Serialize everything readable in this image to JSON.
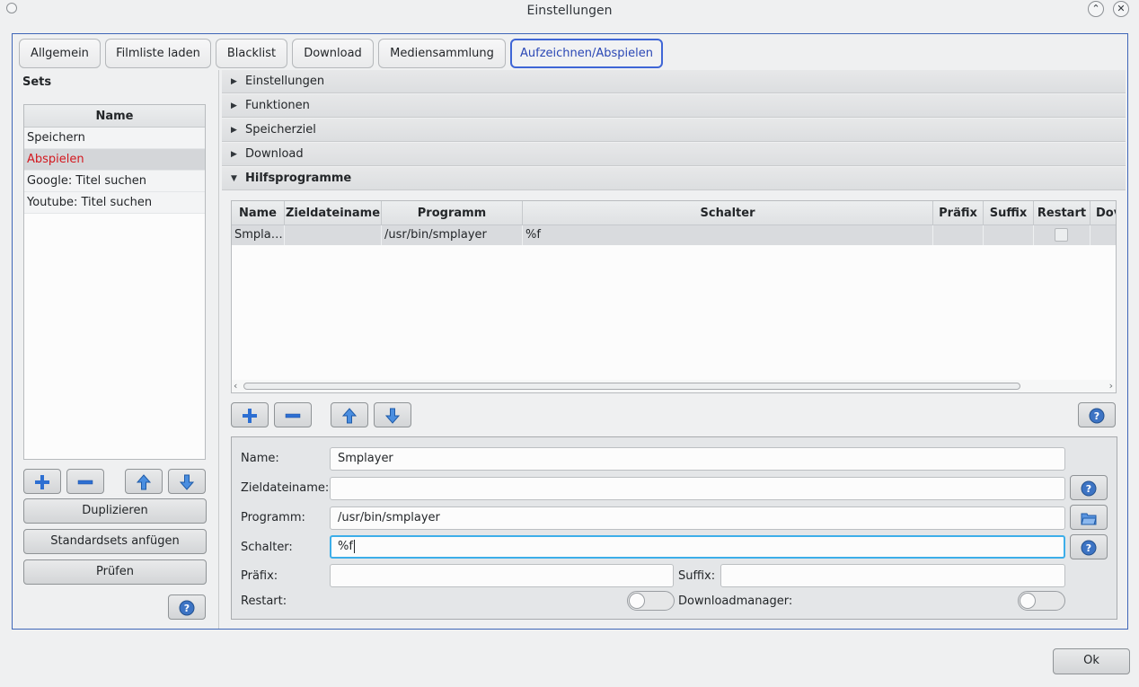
{
  "window": {
    "title": "Einstellungen"
  },
  "tabs": [
    "Allgemein",
    "Filmliste laden",
    "Blacklist",
    "Download",
    "Mediensammlung",
    "Aufzeichnen/Abspielen"
  ],
  "sets": {
    "header": "Sets",
    "column": "Name",
    "items": [
      "Speichern",
      "Abspielen",
      "Google: Titel suchen",
      "Youtube: Titel suchen"
    ],
    "duplicate_label": "Duplizieren",
    "add_defaults_label": "Standardsets anfügen",
    "check_label": "Prüfen"
  },
  "sections": [
    "Einstellungen",
    "Funktionen",
    "Speicherziel",
    "Download",
    "Hilfsprogramme"
  ],
  "table": {
    "columns": [
      "Name",
      "Zieldateiname",
      "Programm",
      "Schalter",
      "Präfix",
      "Suffix",
      "Restart",
      "Dov"
    ],
    "rows": [
      {
        "name": "Smpla…",
        "target": "",
        "program": "/usr/bin/smplayer",
        "switch": "%f"
      }
    ]
  },
  "form": {
    "name_label": "Name:",
    "name_value": "Smplayer",
    "target_label": "Zieldateiname:",
    "target_value": "",
    "program_label": "Programm:",
    "program_value": "/usr/bin/smplayer",
    "switch_label": "Schalter:",
    "switch_value": "%f",
    "prefix_label": "Präfix:",
    "prefix_value": "",
    "suffix_label": "Suffix:",
    "suffix_value": "",
    "restart_label": "Restart:",
    "downloadmanager_label": "Downloadmanager:"
  },
  "footer": {
    "ok_label": "Ok"
  },
  "colors": {
    "accent": "#3f66d6",
    "selected_text": "#d3181f",
    "focus": "#3daee9",
    "icon_blue": "#2d6fd2"
  },
  "icons": [
    "plus-icon",
    "minus-icon",
    "arrow-up-icon",
    "arrow-down-icon",
    "help-icon",
    "folder-open-icon",
    "minimize-icon",
    "close-icon"
  ]
}
